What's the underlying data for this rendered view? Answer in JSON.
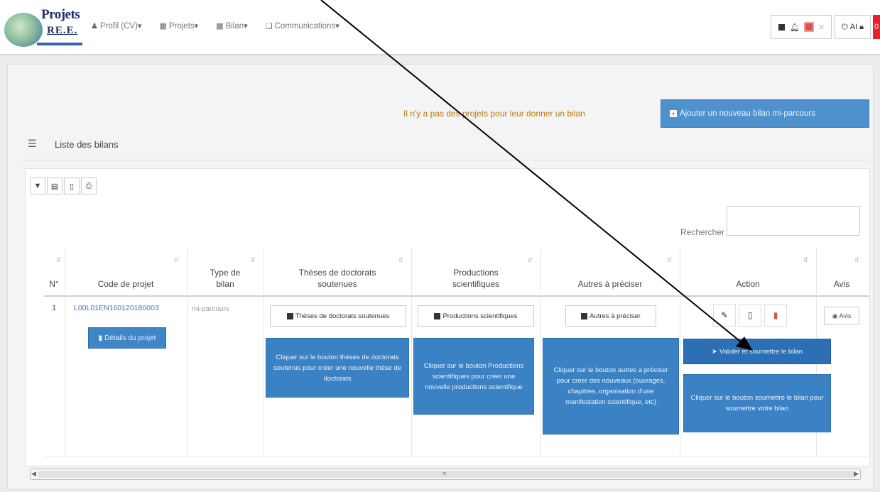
{
  "navbar": {
    "logo_line1": "Projets",
    "logo_line2": "RE.E.",
    "menu": [
      {
        "icon": "user-icon",
        "glyph": "♟",
        "label": "Profil (CV)"
      },
      {
        "icon": "grid-icon",
        "glyph": "▦",
        "label": "Projets"
      },
      {
        "icon": "grid-icon",
        "glyph": "▦",
        "label": "Bilan"
      },
      {
        "icon": "chat-icon",
        "glyph": "❑",
        "label": "Communications"
      }
    ],
    "user_initials": "AI",
    "notif_count": "0"
  },
  "notice": "Il n'y a pas des projets pour leur donner un bilan",
  "add_button": "Ajouter un nouveau bilan mi-parcours",
  "list_title": "Liste des bilans",
  "search_label": "Rechercher :",
  "table": {
    "headers": {
      "num": "N°",
      "code": "Code de projet",
      "type": "Type de bilan",
      "theses": "Thèses de doctorats soutenues",
      "productions": "Productions scientifiques",
      "autres": "Autres à préciser",
      "action": "Action",
      "avis": "Avis"
    },
    "row": {
      "num": "1",
      "code": "L00L01EN160120180003",
      "details_button": "Détails du projet",
      "type": "mi-parcours",
      "theses_button": "Thèses de doctorats soutenues",
      "theses_help": "Cliquer sur le bouton thèses de doctorats soutenus pour créer une nouvelle thèse de doctorats",
      "productions_button": "Productions scientifiques",
      "productions_help": "Cliquer sur le bouton Productions scientifiques pour créer une nouvelle productions scientifique",
      "autres_button": "Autres à préciser",
      "autres_help": "Cliquer sur le bouton autres à préciser pour créer des nouveaux (ouvrages, chapitres, organisation d'une manifestation scientifique, etc)",
      "valider_button": "Valider et soumettre le bilan",
      "valider_help": "Cliquer sur le bouton soumettre le bilan pour soumettre votre bilan",
      "avis_button": "Avis"
    }
  }
}
